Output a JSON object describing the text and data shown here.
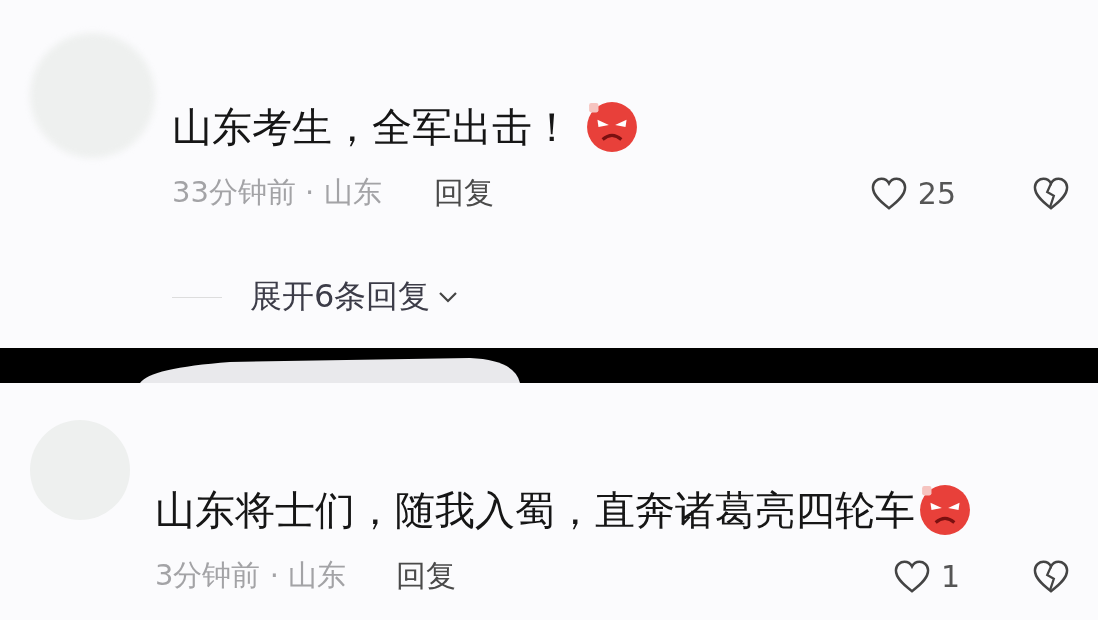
{
  "comments": [
    {
      "text": "山东考生，全军出击！",
      "time": "33分钟前 · 山东",
      "reply": "回复",
      "likes": "25",
      "expand": "展开6条回复"
    },
    {
      "text": "山东将士们，随我入蜀，直奔诸葛亮四轮车",
      "time": "3分钟前 · 山东",
      "reply": "回复",
      "likes": "1"
    }
  ]
}
